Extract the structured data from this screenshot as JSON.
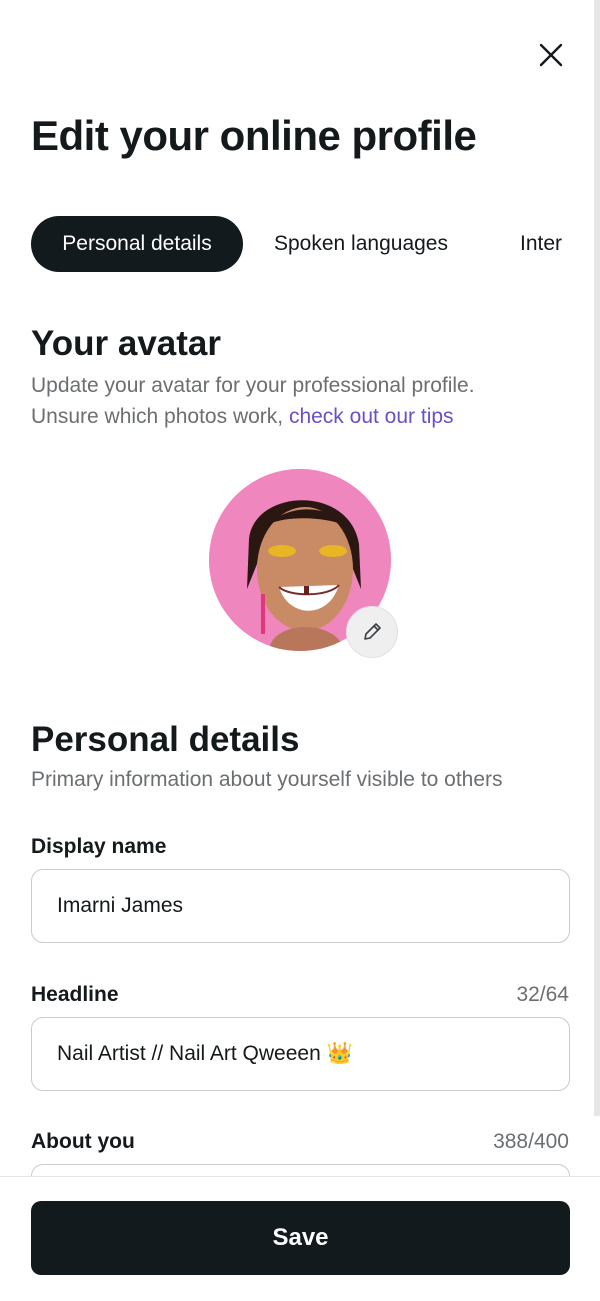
{
  "header": {
    "title": "Edit your online profile",
    "close_icon": "close-icon"
  },
  "tabs": [
    {
      "label": "Personal details",
      "active": true
    },
    {
      "label": "Spoken languages",
      "active": false
    },
    {
      "label": "Inter",
      "active": false
    }
  ],
  "avatar_section": {
    "title": "Your avatar",
    "desc_line1": "Update your avatar for your professional profile.",
    "desc_line2_prefix": "Unsure which photos work, ",
    "tips_link": "check out our tips",
    "edit_icon": "pencil-icon"
  },
  "personal_section": {
    "title": "Personal details",
    "subtitle": "Primary information about yourself visible to others"
  },
  "fields": {
    "display_name": {
      "label": "Display name",
      "value": "Imarni James"
    },
    "headline": {
      "label": "Headline",
      "counter": "32/64",
      "value": "Nail Artist // Nail Art Qweeen 👑"
    },
    "about": {
      "label": "About you",
      "counter": "388/400"
    }
  },
  "footer": {
    "save_label": "Save"
  },
  "colors": {
    "primary_dark": "#121a1d",
    "link": "#6a4fc5",
    "muted_text": "#6b6f72",
    "avatar_bg": "#ef86bd"
  }
}
